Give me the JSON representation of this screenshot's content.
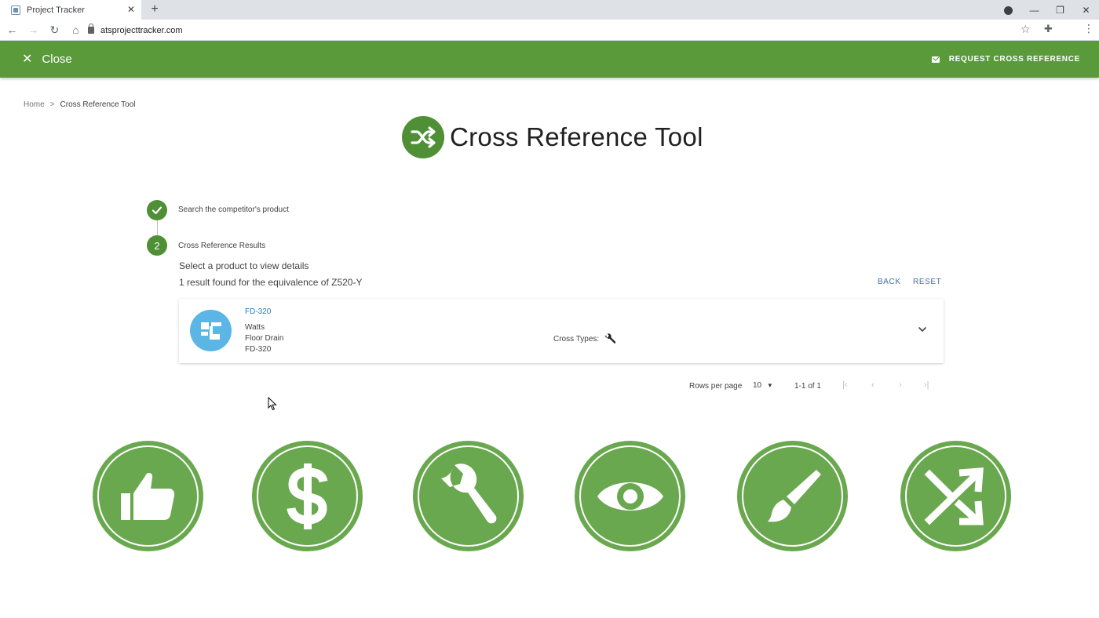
{
  "browser": {
    "tab_title": "Project Tracker",
    "url": "atsprojecttracker.com"
  },
  "header": {
    "close_label": "Close",
    "request_label": "REQUEST CROSS REFERENCE"
  },
  "breadcrumb": {
    "home": "Home",
    "separator": ">",
    "current": "Cross Reference Tool"
  },
  "page": {
    "title": "Cross Reference Tool"
  },
  "stepper": {
    "step1": {
      "label": "Search the competitor's product",
      "status": "complete"
    },
    "step2": {
      "number": "2",
      "label": "Cross Reference Results"
    },
    "subtitle": "Select a product to view details",
    "results_text": "1 result found for the equivalence of Z520-Y",
    "back_label": "BACK",
    "reset_label": "RESET"
  },
  "result": {
    "code": "FD-320",
    "manufacturer": "Watts",
    "category": "Floor Drain",
    "model": "FD-320",
    "cross_types_label": "Cross Types:",
    "cross_type_icon": "wrench-icon"
  },
  "pagination": {
    "rows_label": "Rows per page",
    "rows_value": "10",
    "range": "1-1 of 1"
  },
  "features": [
    {
      "icon": "thumbs-up-icon"
    },
    {
      "icon": "dollar-icon"
    },
    {
      "icon": "wrench-icon"
    },
    {
      "icon": "eye-icon"
    },
    {
      "icon": "paintbrush-icon"
    },
    {
      "icon": "shuffle-icon"
    }
  ],
  "colors": {
    "header_green": "#5a9a3b",
    "feature_green": "#6aa84f",
    "link_blue": "#3b6fa8",
    "avatar_blue": "#5bb6e6"
  }
}
